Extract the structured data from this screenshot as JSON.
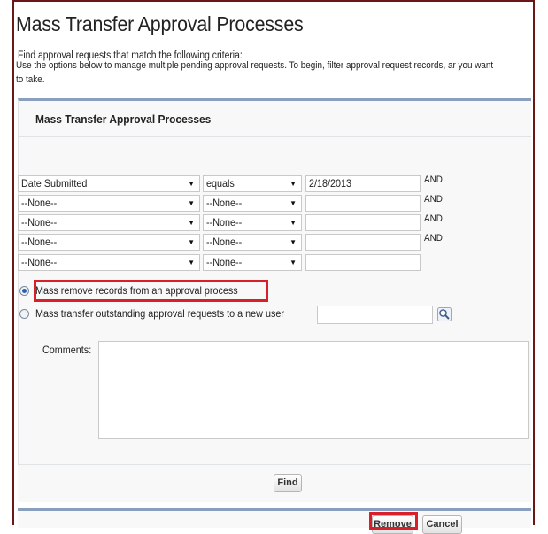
{
  "page": {
    "title": "Mass Transfer Approval Processes",
    "description": "Use the options below to manage multiple pending approval requests. To begin, filter approval request records, ar you want to take."
  },
  "panel": {
    "title": "Mass Transfer Approval Processes",
    "criteria_label": "Find approval requests that match the following criteria:"
  },
  "criteria": [
    {
      "field": "Date Submitted",
      "operator": "equals",
      "value": "2/18/2013",
      "connector": "AND"
    },
    {
      "field": "--None--",
      "operator": "--None--",
      "value": "",
      "connector": "AND"
    },
    {
      "field": "--None--",
      "operator": "--None--",
      "value": "",
      "connector": "AND"
    },
    {
      "field": "--None--",
      "operator": "--None--",
      "value": "",
      "connector": "AND"
    },
    {
      "field": "--None--",
      "operator": "--None--",
      "value": "",
      "connector": ""
    }
  ],
  "options": {
    "remove_label": "Mass remove records from an approval process",
    "transfer_label": "Mass transfer outstanding approval requests to a new user",
    "selected": "remove"
  },
  "user_input": {
    "value": ""
  },
  "comments": {
    "label": "Comments:",
    "value": ""
  },
  "buttons": {
    "find": "Find",
    "remove": "Remove",
    "cancel": "Cancel"
  },
  "colors": {
    "highlight": "#d8202a",
    "panel_border": "#8a9ebe",
    "window_border": "#6b1717"
  },
  "icons": {
    "lookup": "magnifier-lookup-icon"
  }
}
